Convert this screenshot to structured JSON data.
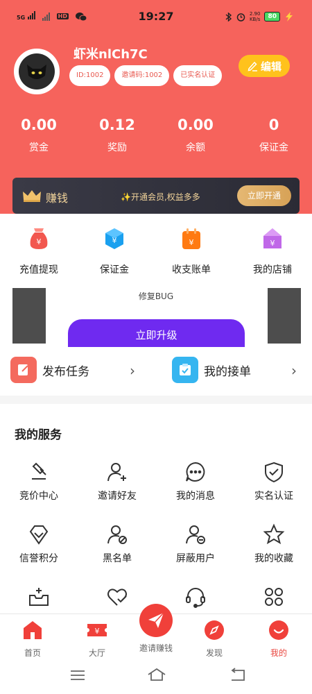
{
  "status_bar": {
    "network": "5G",
    "hd": "HD",
    "time": "19:27",
    "speed_value": "2.90",
    "speed_unit": "KB/s",
    "battery": "80"
  },
  "profile": {
    "username": "虾米nlCh7C",
    "chips": [
      "ID:1002",
      "邀请码:1002",
      "已实名认证"
    ],
    "edit_label": "编辑"
  },
  "stats": [
    {
      "value": "0.00",
      "label": "赏金"
    },
    {
      "value": "0.12",
      "label": "奖励"
    },
    {
      "value": "0.00",
      "label": "余额"
    },
    {
      "value": "0",
      "label": "保证金"
    }
  ],
  "vip": {
    "title": "赚钱",
    "desc": "✨开通会员,权益多多",
    "button": "立即开通"
  },
  "quick": [
    {
      "label": "充值提现",
      "icon": "money-bag-icon",
      "color": "#f2574f"
    },
    {
      "label": "保证金",
      "icon": "hexagon-yen-icon",
      "color": "#1aa0ef"
    },
    {
      "label": "收支账单",
      "icon": "calendar-yen-icon",
      "color": "#ff7a12"
    },
    {
      "label": "我的店铺",
      "icon": "shop-yen-icon",
      "color": "#c068e8"
    }
  ],
  "update": {
    "title": "修复BUG",
    "button": "立即升级"
  },
  "tasks": [
    {
      "label": "发布任务"
    },
    {
      "label": "我的接单"
    }
  ],
  "services": {
    "title": "我的服务",
    "items": [
      {
        "label": "竞价中心",
        "icon": "gavel-icon"
      },
      {
        "label": "邀请好友",
        "icon": "add-user-icon"
      },
      {
        "label": "我的消息",
        "icon": "message-icon"
      },
      {
        "label": "实名认证",
        "icon": "shield-check-icon"
      },
      {
        "label": "信誉积分",
        "icon": "diamond-icon"
      },
      {
        "label": "黑名单",
        "icon": "block-user-icon"
      },
      {
        "label": "屏蔽用户",
        "icon": "mute-user-icon"
      },
      {
        "label": "我的收藏",
        "icon": "star-icon"
      },
      {
        "label": "",
        "icon": "inbox-plus-icon"
      },
      {
        "label": "",
        "icon": "heart-check-icon"
      },
      {
        "label": "",
        "icon": "headset-icon"
      },
      {
        "label": "",
        "icon": "grid-icon"
      }
    ]
  },
  "tabbar": {
    "items": [
      {
        "label": "首页",
        "icon": "home-icon"
      },
      {
        "label": "大厅",
        "icon": "ticket-yen-icon"
      },
      {
        "label": "邀请赚钱",
        "icon": "paper-plane-icon"
      },
      {
        "label": "发现",
        "icon": "compass-icon"
      },
      {
        "label": "我的",
        "icon": "profile-icon"
      }
    ],
    "active": "我的"
  },
  "colors": {
    "brand_red": "#f6635c",
    "edit_yellow": "#ffc21c",
    "upgrade_purple": "#6f2af0",
    "vip_gold": "#f1d39a"
  }
}
